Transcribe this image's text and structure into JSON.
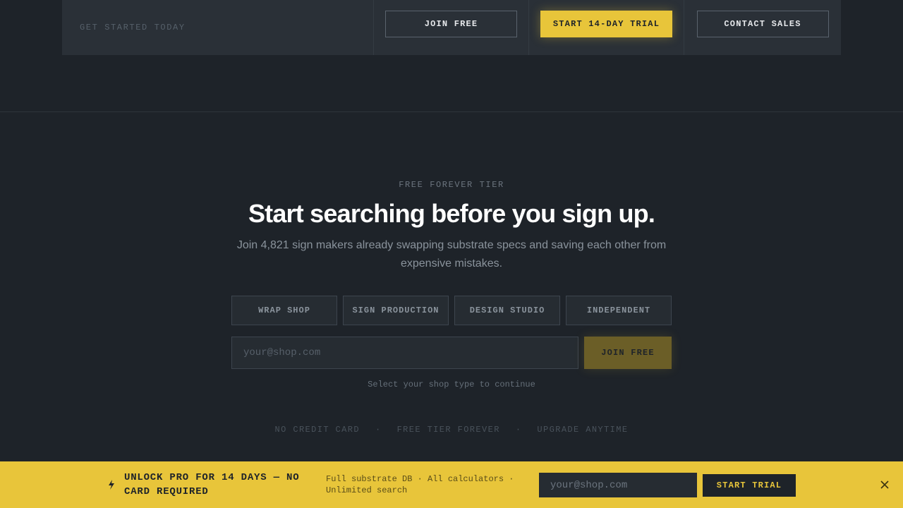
{
  "top_band": {
    "label": "GET STARTED TODAY",
    "join_free": "JOIN FREE",
    "start_trial": "START 14-DAY TRIAL",
    "contact_sales": "CONTACT SALES"
  },
  "signup": {
    "eyebrow": "FREE FOREVER TIER",
    "headline": "Start searching before you sign up.",
    "subtext": "Join 4,821 sign makers already swapping substrate specs and saving each other from expensive mistakes.",
    "shop_types": [
      "WRAP SHOP",
      "SIGN PRODUCTION",
      "DESIGN STUDIO",
      "INDEPENDENT"
    ],
    "email_placeholder": "your@shop.com",
    "join_label": "JOIN FREE",
    "hint": "Select your shop type to continue",
    "assurances": [
      "NO CREDIT CARD",
      "FREE TIER FOREVER",
      "UPGRADE ANYTIME"
    ],
    "separator": "·"
  },
  "promo_bar": {
    "icon": "lightning-bolt-icon",
    "title": "UNLOCK PRO FOR 14 DAYS — NO CARD REQUIRED",
    "features": "Full substrate DB · All calculators · Unlimited search",
    "email_placeholder": "your@shop.com",
    "button_label": "START TRIAL",
    "close_icon": "close-icon"
  },
  "colors": {
    "background": "#1e2329",
    "accent": "#e8c53a",
    "panel": "#2a3037"
  }
}
